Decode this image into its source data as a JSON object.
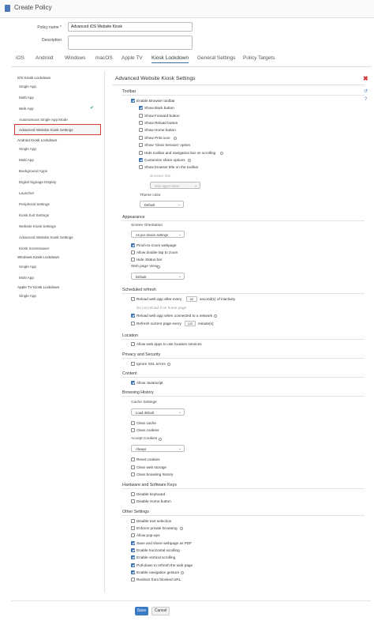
{
  "header": {
    "title": "Create Policy",
    "icon": "document-icon"
  },
  "form": {
    "policy_name_label": "Policy name *",
    "policy_name_value": "Advanced iOS Website Kiosk",
    "description_label": "Description",
    "description_value": ""
  },
  "tabs": [
    "iOS",
    "Android",
    "Windows",
    "macOS",
    "Apple TV",
    "Kiosk Lockdown",
    "General Settings",
    "Policy Targets"
  ],
  "active_tab": "Kiosk Lockdown",
  "sidebar": [
    {
      "label": "iOS Kiosk Lockdown",
      "group": true
    },
    {
      "label": "Single App"
    },
    {
      "label": "Multi App"
    },
    {
      "label": "Web App",
      "checked": true
    },
    {
      "label": "Autonomous Single App Mode"
    },
    {
      "label": "Advanced Website Kiosk Settings",
      "selected": true
    },
    {
      "label": "Android Kiosk Lockdown",
      "group": true
    },
    {
      "label": "Single App"
    },
    {
      "label": "Multi App"
    },
    {
      "label": "Background Apps"
    },
    {
      "label": "Digital Signage Display"
    },
    {
      "label": "Launcher"
    },
    {
      "label": "Peripheral Settings"
    },
    {
      "label": "Kiosk Exit Settings"
    },
    {
      "label": "Website Kiosk Settings"
    },
    {
      "label": "Advanced Website Kiosk Settings"
    },
    {
      "label": "Kiosk Screensaver"
    },
    {
      "label": "Windows Kiosk Lockdown",
      "group": true
    },
    {
      "label": "Single App"
    },
    {
      "label": "Multi App"
    },
    {
      "label": "Apple TV Kiosk Lockdown",
      "group": true
    },
    {
      "label": "Single App"
    }
  ],
  "content": {
    "title": "Advanced Website Kiosk Settings",
    "toolbar": {
      "title": "Toolbar",
      "enable_label": "Enable Browser toolbar",
      "options": [
        {
          "label": "Show Back button",
          "checked": true
        },
        {
          "label": "Show Forward button",
          "checked": false
        },
        {
          "label": "Show Reload button",
          "checked": false
        },
        {
          "label": "Show Home button",
          "checked": false
        },
        {
          "label": "Show Print icon",
          "checked": false
        },
        {
          "label": "Show 'Clear Session' option",
          "checked": false
        },
        {
          "label": "Hide toolbar and navigation bar on scrolling",
          "checked": false
        },
        {
          "label": "Customize share options",
          "checked": true
        },
        {
          "label": "Show browser title on the toolbar",
          "checked": false
        }
      ],
      "browser_title_label": "Browser title",
      "browser_title_value": "Web app's name",
      "theme_label": "Theme color",
      "theme_value": "Default"
    },
    "appearance": {
      "title": "Appearance",
      "orientation_label": "Screen Orientation",
      "orientation_value": "As per device settings",
      "pinch_label": "Pinch-to-zoom webpage",
      "double_tap_label": "Allow double tap to zoom",
      "hide_status_label": "Hide Status bar",
      "view_label": "Web page View",
      "view_value": "Default"
    },
    "refresh": {
      "title": "Scheduled refresh",
      "reload_after_label": "Reload web app after every",
      "reload_after_value": "60",
      "reload_after_suffix": "second(s) of inactivity",
      "not_reload_label": "Do not reload if on home page",
      "reload_network_label": "Reload web app when connected to a network",
      "refresh_current_label": "Refresh current page every",
      "refresh_current_value": "120",
      "refresh_current_suffix": "minute(s)"
    },
    "location": {
      "title": "Location",
      "allow_label": "Allow web apps to use location services"
    },
    "privacy": {
      "title": "Privacy and Security",
      "ignore_ssl_label": "Ignore SSL errors"
    },
    "content_sec": {
      "title": "Content",
      "allow_js_label": "Allow Javascript"
    },
    "history": {
      "title": "Browsing History",
      "cache_label": "Cache Settings",
      "cache_value": "Load default",
      "clear_cache_label": "Clear cache",
      "clear_cookies_label": "Clear cookies",
      "accept_cookies_label": "Accept Cookies",
      "accept_cookies_value": "Always",
      "reset_cookies_label": "Reset cookies",
      "clear_storage_label": "Clear web storage",
      "clear_history_label": "Clear browsing history"
    },
    "hardware": {
      "title": "Hardware and Software Keys",
      "disable_keyboard_label": "Disable keyboard",
      "disable_home_label": "Disable Home button"
    },
    "other": {
      "title": "Other Settings",
      "options": [
        {
          "label": "Disable text selection",
          "checked": false
        },
        {
          "label": "Enforce private browsing",
          "checked": false
        },
        {
          "label": "Allow pop-ups",
          "checked": false
        },
        {
          "label": "Save and share webpage as PDF",
          "checked": true
        },
        {
          "label": "Enable horizontal scrolling",
          "checked": true
        },
        {
          "label": "Enable vertical scrolling",
          "checked": true
        },
        {
          "label": "Pull-down to refresh the web page",
          "checked": true
        },
        {
          "label": "Enable navigation gesture",
          "checked": true
        },
        {
          "label": "Redirect from blocked URL",
          "checked": false
        }
      ]
    }
  },
  "buttons": {
    "save": "Save",
    "cancel": "Cancel"
  },
  "colors": {
    "accent": "#3a6fb0",
    "selected_border": "#d43b3b",
    "check": "#3ba55d"
  }
}
